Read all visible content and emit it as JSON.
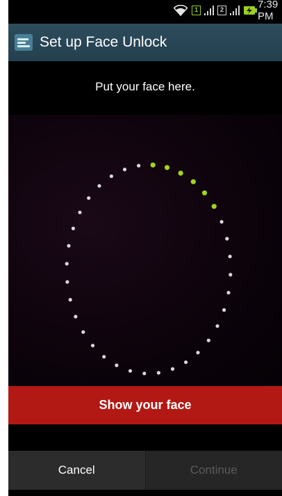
{
  "status_bar": {
    "sim1_label": "1",
    "sim2_label": "2",
    "time": "7:39 PM",
    "icons": [
      "wifi-icon",
      "sim1-icon",
      "signal1-icon",
      "sim2-icon",
      "signal2-icon",
      "battery-charging-icon"
    ]
  },
  "action_bar": {
    "title": "Set up Face Unlock",
    "icon": "face-unlock-settings-icon"
  },
  "instruction": "Put your face here.",
  "face_guide": {
    "total_dots": 36,
    "highlighted_dots": 6,
    "dot_color": "#d9d9d9",
    "highlight_color": "#a4d51a"
  },
  "status_banner": "Show your face",
  "footer": {
    "cancel_label": "Cancel",
    "continue_label": "Continue"
  },
  "colors": {
    "action_bar": "#2b4a5a",
    "banner": "#b31914",
    "accent_green": "#9ed11e"
  }
}
